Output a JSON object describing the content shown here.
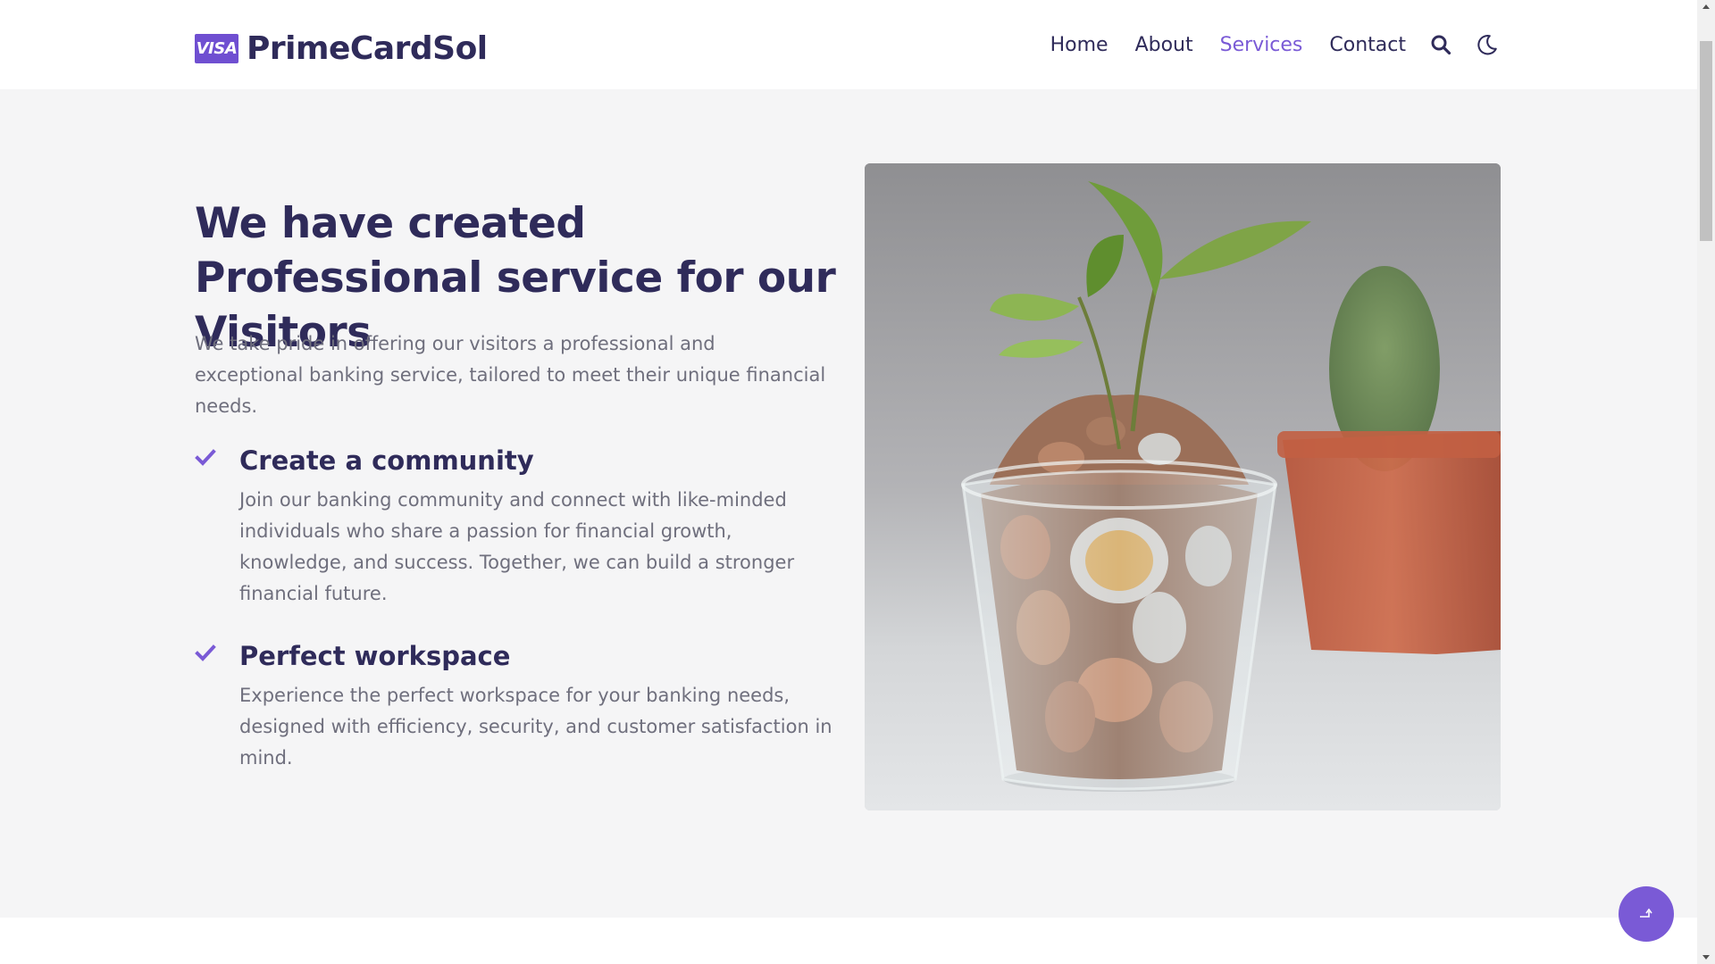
{
  "brand": {
    "badge": "VISA",
    "name": "PrimeCardSol"
  },
  "nav": {
    "items": [
      {
        "label": "Home"
      },
      {
        "label": "About"
      },
      {
        "label": "Services",
        "active": true
      },
      {
        "label": "Contact"
      }
    ],
    "search_icon": "search-icon",
    "theme_icon": "moon-icon"
  },
  "hero": {
    "title": "We have created Professional service for our Visitors",
    "lead": "We take pride in offering our visitors a professional and exceptional banking service, tailored to meet their unique financial needs.",
    "features": [
      {
        "title": "Create a community",
        "text": "Join our banking community and connect with like-minded individuals who share a passion for financial growth, knowledge, and success. Together, we can build a stronger financial future."
      },
      {
        "title": "Perfect workspace",
        "text": "Experience the perfect workspace for your banking needs, designed with efficiency, security, and customer satisfaction in mind."
      }
    ],
    "image_icon": "plant-in-coins-photo"
  },
  "back_to_top_icon": "arrow-up-icon",
  "colors": {
    "accent": "#7a5ad6",
    "heading": "#2f2b5a",
    "body_text": "#6f6f7d",
    "background": "#f5f5f6"
  }
}
